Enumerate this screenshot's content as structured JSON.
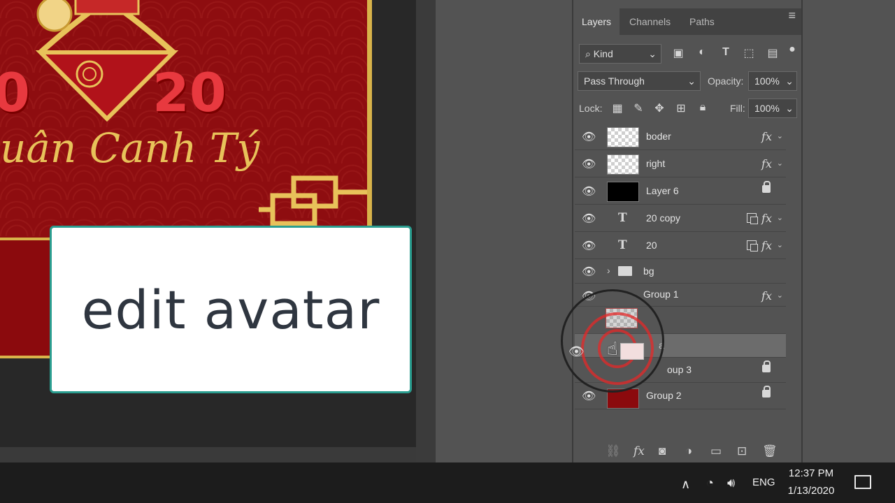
{
  "artwork": {
    "year_left": "0",
    "year_right": "20",
    "caption": "uân Canh Tý"
  },
  "overlay": {
    "caption": "edit avatar"
  },
  "layers_panel": {
    "tabs": [
      {
        "label": "Layers",
        "active": true
      },
      {
        "label": "Channels",
        "active": false
      },
      {
        "label": "Paths",
        "active": false
      }
    ],
    "filter_kind": "Kind",
    "blend_mode": "Pass Through",
    "opacity_label": "Opacity:",
    "opacity_value": "100%",
    "lock_label": "Lock:",
    "fill_label": "Fill:",
    "fill_value": "100%",
    "layers": [
      {
        "name": "boder",
        "kind": "pixel",
        "fx": true
      },
      {
        "name": "right",
        "kind": "pixel",
        "fx": true
      },
      {
        "name": "Layer 6",
        "kind": "pixel-black",
        "locked": true
      },
      {
        "name": "20 copy",
        "kind": "text",
        "fx": true,
        "smart": true
      },
      {
        "name": "20",
        "kind": "text",
        "fx": true,
        "smart": true
      },
      {
        "name": "bg",
        "kind": "group"
      },
      {
        "name": "Group 1",
        "kind": "group",
        "fx": true
      },
      {
        "name": "",
        "kind": "pixel"
      },
      {
        "name": "a",
        "kind": "group",
        "selected": true
      },
      {
        "name": "oup 3",
        "kind": "group",
        "locked": true
      },
      {
        "name": "Group 2",
        "kind": "pixel-red",
        "locked": true
      }
    ]
  },
  "taskbar": {
    "language": "ENG",
    "time": "12:37 PM",
    "date": "1/13/2020"
  },
  "colors": {
    "panel_bg": "#535353",
    "artwork_red": "#8e0d10",
    "gold": "#d8b34a",
    "caption_border": "#2a9d8f",
    "cursor_ring": "#e62828"
  }
}
